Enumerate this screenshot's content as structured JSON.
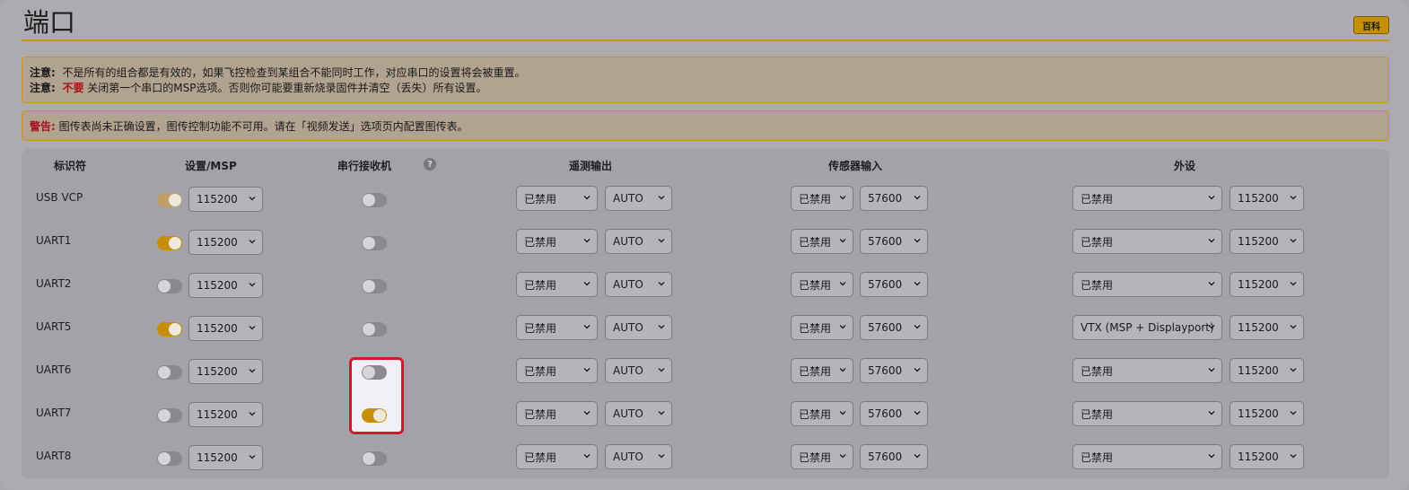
{
  "page": {
    "title": "端口",
    "wiki_label": "百科"
  },
  "notes": {
    "line1_label": "注意:",
    "line1_text": "不是所有的组合都是有效的，如果飞控检查到某组合不能同时工作，对应串口的设置将会被重置。",
    "line2_label": "注意:",
    "line2_warn": "不要",
    "line2_text": "关闭第一个串口的MSP选项。否则你可能要重新烧录固件并清空（丢失）所有设置。",
    "warning_label": "警告:",
    "warning_text": "图传表尚未正确设置，图传控制功能不可用。请在「视频发送」选项页内配置图传表。"
  },
  "table": {
    "headers": {
      "identifier": "标识符",
      "config_msp": "设置/MSP",
      "serial_rx": "串行接收机",
      "telemetry": "遥测输出",
      "sensors": "传感器输入",
      "peripherals": "外设"
    },
    "help_icon": "?",
    "rows": [
      {
        "id": "USB VCP",
        "msp": true,
        "msp_locked": true,
        "msp_baud": "115200",
        "rx": false,
        "tel": "已禁用",
        "tel_baud": "AUTO",
        "sensor": "已禁用",
        "sensor_baud": "57600",
        "periph": "已禁用",
        "periph_baud": "115200"
      },
      {
        "id": "UART1",
        "msp": true,
        "msp_locked": false,
        "msp_baud": "115200",
        "rx": false,
        "tel": "已禁用",
        "tel_baud": "AUTO",
        "sensor": "已禁用",
        "sensor_baud": "57600",
        "periph": "已禁用",
        "periph_baud": "115200"
      },
      {
        "id": "UART2",
        "msp": false,
        "msp_locked": false,
        "msp_baud": "115200",
        "rx": false,
        "tel": "已禁用",
        "tel_baud": "AUTO",
        "sensor": "已禁用",
        "sensor_baud": "57600",
        "periph": "已禁用",
        "periph_baud": "115200"
      },
      {
        "id": "UART5",
        "msp": true,
        "msp_locked": false,
        "msp_baud": "115200",
        "rx": false,
        "tel": "已禁用",
        "tel_baud": "AUTO",
        "sensor": "已禁用",
        "sensor_baud": "57600",
        "periph": "VTX (MSP + Displayport)",
        "periph_baud": "115200"
      },
      {
        "id": "UART6",
        "msp": false,
        "msp_locked": false,
        "msp_baud": "115200",
        "rx": false,
        "tel": "已禁用",
        "tel_baud": "AUTO",
        "sensor": "已禁用",
        "sensor_baud": "57600",
        "periph": "已禁用",
        "periph_baud": "115200"
      },
      {
        "id": "UART7",
        "msp": false,
        "msp_locked": false,
        "msp_baud": "115200",
        "rx": true,
        "tel": "已禁用",
        "tel_baud": "AUTO",
        "sensor": "已禁用",
        "sensor_baud": "57600",
        "periph": "已禁用",
        "periph_baud": "115200"
      },
      {
        "id": "UART8",
        "msp": false,
        "msp_locked": false,
        "msp_baud": "115200",
        "rx": false,
        "tel": "已禁用",
        "tel_baud": "AUTO",
        "sensor": "已禁用",
        "sensor_baud": "57600",
        "periph": "已禁用",
        "periph_baud": "115200"
      }
    ]
  },
  "colors": {
    "accent": "#c58f0a",
    "warning_red": "#a8141e",
    "highlight_border": "#d5172b"
  },
  "icons": {
    "dropdown": "chevron-down-icon",
    "help": "help-circle-icon"
  }
}
